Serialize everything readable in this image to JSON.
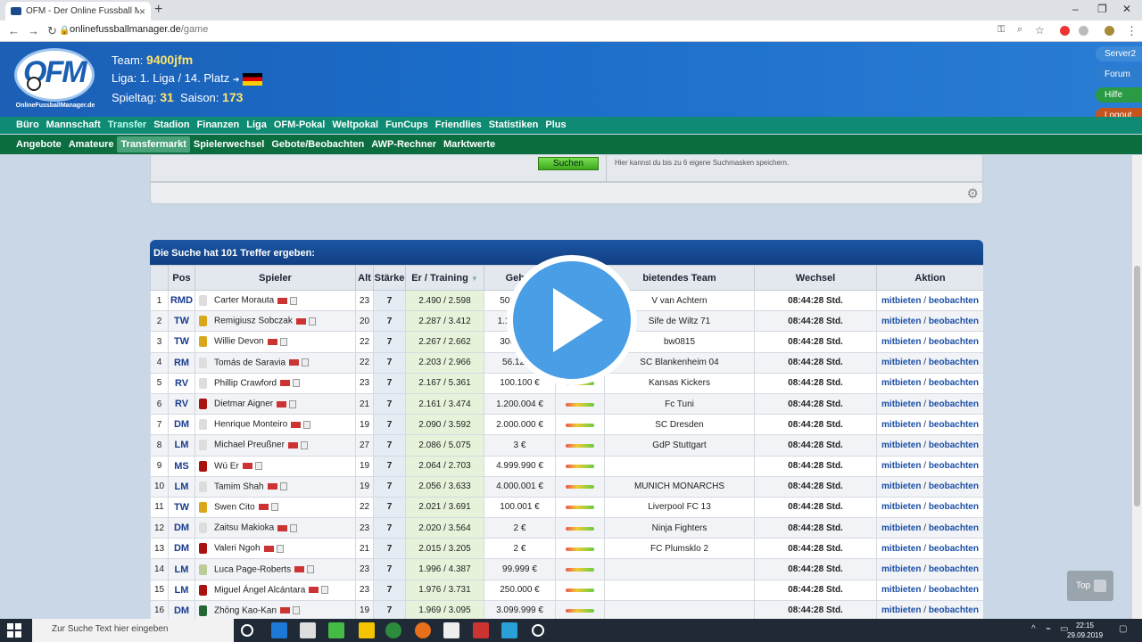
{
  "browser": {
    "tab_title": "OFM - Der Online Fussball Mana...",
    "url_host": "onlinefussballmanager.de",
    "url_path": "/game"
  },
  "header": {
    "team_label": "Team:",
    "team_name": "9400jfm",
    "liga_text": "Liga: 1. Liga  /  14. Platz",
    "spieltag_label": "Spieltag:",
    "spieltag": "31",
    "saison_label": "Saison:",
    "saison": "173",
    "logo_sub": "OnlineFussballManager.de"
  },
  "side_buttons": [
    "Server2",
    "Forum",
    "Hilfe",
    "Logout"
  ],
  "menu1": [
    "Büro",
    "Mannschaft",
    "Transfer",
    "Stadion",
    "Finanzen",
    "Liga",
    "OFM-Pokal",
    "Weltpokal",
    "FunCups",
    "Friendlies",
    "Statistiken",
    "Plus"
  ],
  "menu2": [
    "Angebote",
    "Amateure",
    "Transfermarkt",
    "Spielerwechsel",
    "Gebote/Beobachten",
    "AWP-Rechner",
    "Marktwerte"
  ],
  "search": {
    "button": "Suchen",
    "hint": "Hier kannst du bis zu 6 eigene Suchmasken speichern."
  },
  "results": {
    "title": "Die Suche hat 101 Treffer ergeben:",
    "columns": [
      "",
      "Pos",
      "Spieler",
      "Alt",
      "Stärke",
      "Er / Training",
      "Gebot",
      "",
      "bietendes Team",
      "Wechsel",
      "Aktion"
    ],
    "action_bid": "mitbieten",
    "action_sep": "/",
    "action_watch": "beobachten",
    "rows": [
      {
        "n": "1",
        "pos": "RMD",
        "name": "Carter Morauta",
        "alt": "23",
        "st": "7",
        "et": "2.490 / 2.598",
        "gebot": "500.000 €",
        "team": "V van Achtern",
        "wechsel": "08:44:28 Std.",
        "shirt": "#ddd"
      },
      {
        "n": "2",
        "pos": "TW",
        "name": "Remigiusz Sobczak",
        "alt": "20",
        "st": "7",
        "et": "2.287 / 3.412",
        "gebot": "1.111.111 €",
        "team": "Sife de Wiltz 71",
        "wechsel": "08:44:28 Std.",
        "shirt": "#d9a81a"
      },
      {
        "n": "3",
        "pos": "TW",
        "name": "Willie Devon",
        "alt": "22",
        "st": "7",
        "et": "2.267 / 2.662",
        "gebot": "300.000 €",
        "team": "bw0815",
        "wechsel": "08:44:28 Std.",
        "shirt": "#d9a81a"
      },
      {
        "n": "4",
        "pos": "RM",
        "name": "Tomás de Saravia",
        "alt": "22",
        "st": "7",
        "et": "2.203 / 2.966",
        "gebot": "56.123 €",
        "team": "SC Blankenheim 04",
        "wechsel": "08:44:28 Std.",
        "shirt": "#ddd"
      },
      {
        "n": "5",
        "pos": "RV",
        "name": "Phillip Crawford",
        "alt": "23",
        "st": "7",
        "et": "2.167 / 5.361",
        "gebot": "100.100 €",
        "team": "Kansas Kickers",
        "wechsel": "08:44:28 Std.",
        "shirt": "#ddd"
      },
      {
        "n": "6",
        "pos": "RV",
        "name": "Dietmar Aigner",
        "alt": "21",
        "st": "7",
        "et": "2.161 / 3.474",
        "gebot": "1.200.004 €",
        "team": "Fc Tuni",
        "wechsel": "08:44:28 Std.",
        "shirt": "#a11"
      },
      {
        "n": "7",
        "pos": "DM",
        "name": "Henrique Monteiro",
        "alt": "19",
        "st": "7",
        "et": "2.090 / 3.592",
        "gebot": "2.000.000 €",
        "team": "SC Dresden",
        "wechsel": "08:44:28 Std.",
        "shirt": "#ddd"
      },
      {
        "n": "8",
        "pos": "LM",
        "name": "Michael Preußner",
        "alt": "27",
        "st": "7",
        "et": "2.086 / 5.075",
        "gebot": "3 €",
        "team": "GdP Stuttgart",
        "wechsel": "08:44:28 Std.",
        "shirt": "#ddd"
      },
      {
        "n": "9",
        "pos": "MS",
        "name": "Wú Er",
        "alt": "19",
        "st": "7",
        "et": "2.064 / 2.703",
        "gebot": "4.999.990 €",
        "team": "",
        "wechsel": "08:44:28 Std.",
        "shirt": "#a11"
      },
      {
        "n": "10",
        "pos": "LM",
        "name": "Tamim Shah",
        "alt": "19",
        "st": "7",
        "et": "2.056 / 3.633",
        "gebot": "4.000.001 €",
        "team": "MUNICH MONARCHS",
        "wechsel": "08:44:28 Std.",
        "shirt": "#ddd"
      },
      {
        "n": "11",
        "pos": "TW",
        "name": "Swen Cito",
        "alt": "22",
        "st": "7",
        "et": "2.021 / 3.691",
        "gebot": "100.001 €",
        "team": "Liverpool FC 13",
        "wechsel": "08:44:28 Std.",
        "shirt": "#d9a81a"
      },
      {
        "n": "12",
        "pos": "DM",
        "name": "Zaitsu Makioka",
        "alt": "23",
        "st": "7",
        "et": "2.020 / 3.564",
        "gebot": "2 €",
        "team": "Ninja Fighters",
        "wechsel": "08:44:28 Std.",
        "shirt": "#ddd"
      },
      {
        "n": "13",
        "pos": "DM",
        "name": "Valeri Ngoh",
        "alt": "21",
        "st": "7",
        "et": "2.015 / 3.205",
        "gebot": "2 €",
        "team": "FC Plumsklo 2",
        "wechsel": "08:44:28 Std.",
        "shirt": "#a11"
      },
      {
        "n": "14",
        "pos": "LM",
        "name": "Luca Page-Roberts",
        "alt": "23",
        "st": "7",
        "et": "1.996 / 4.387",
        "gebot": "99.999 €",
        "team": "",
        "wechsel": "08:44:28 Std.",
        "shirt": "#bc9"
      },
      {
        "n": "15",
        "pos": "LM",
        "name": "Miguel Ángel Alcántara",
        "alt": "23",
        "st": "7",
        "et": "1.976 / 3.731",
        "gebot": "250.000 €",
        "team": "",
        "wechsel": "08:44:28 Std.",
        "shirt": "#a11"
      },
      {
        "n": "16",
        "pos": "DM",
        "name": "Zhōng Kao-Kan",
        "alt": "19",
        "st": "7",
        "et": "1.969 / 3.095",
        "gebot": "3.099.999 €",
        "team": "",
        "wechsel": "08:44:28 Std.",
        "shirt": "#263"
      }
    ]
  },
  "top_button": "Top",
  "taskbar": {
    "search_placeholder": "Zur Suche Text hier eingeben",
    "time": "22:15",
    "date": "29.09.2019"
  }
}
